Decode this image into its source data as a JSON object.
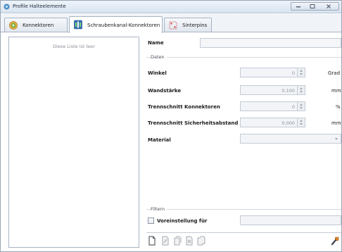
{
  "window": {
    "title": "Profile Halteelemente"
  },
  "tabs": [
    {
      "label": "Konnektoren",
      "icon": "connector-icon",
      "active": false
    },
    {
      "label": "Schraubenkanal-Konnektoren",
      "icon": "screw-channel-icon",
      "active": true
    },
    {
      "label": "Sinterpins",
      "icon": "sinter-pin-icon",
      "active": false
    }
  ],
  "list": {
    "empty_text": "Diese Liste ist leer"
  },
  "form": {
    "name_label": "Name",
    "name_value": "",
    "daten_legend": "Daten",
    "fields": [
      {
        "label": "Winkel",
        "value": "0",
        "unit": "Grad"
      },
      {
        "label": "Wandstärke",
        "value": "0,100",
        "unit": "mm"
      },
      {
        "label": "Trennschnitt Konnektoren",
        "value": "0",
        "unit": "%"
      },
      {
        "label": "Trennschnitt Sicherheitsabstand",
        "value": "0,000",
        "unit": "mm"
      }
    ],
    "material_label": "Material",
    "material_value": "",
    "filter_legend": "Filtern",
    "preset_label": "Voreinstellung für",
    "preset_value": "",
    "preset_checked": false
  },
  "colors": {
    "accent": "#3b7fc4",
    "icon_orange": "#e58a2b",
    "icon_green": "#3a9a3a"
  }
}
